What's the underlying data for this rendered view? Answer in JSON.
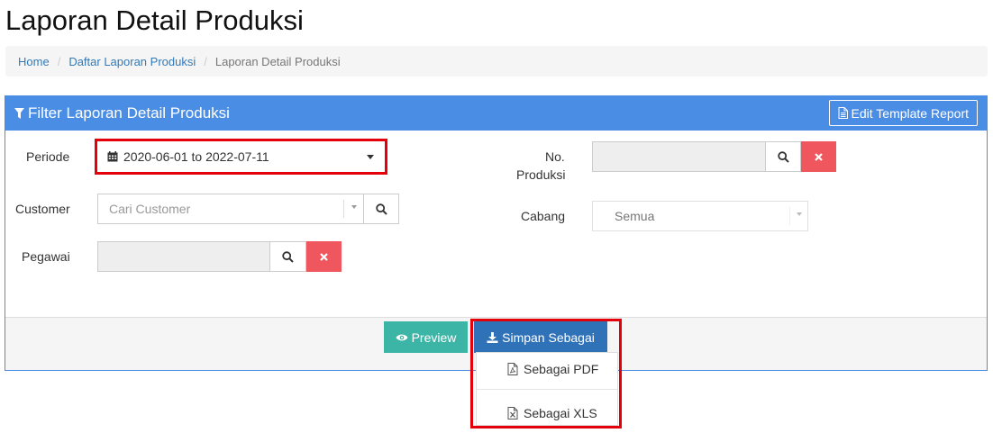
{
  "page": {
    "title": "Laporan Detail Produksi"
  },
  "breadcrumb": {
    "home": "Home",
    "list": "Daftar Laporan Produksi",
    "current": "Laporan Detail Produksi"
  },
  "panel": {
    "title": "Filter Laporan Detail Produksi",
    "edit_template": "Edit Template Report",
    "accent_color": "#4a8de5"
  },
  "filter": {
    "periode_label": "Periode",
    "periode_value": "2020-06-01 to 2022-07-11",
    "customer_label": "Customer",
    "customer_placeholder": "Cari Customer",
    "pegawai_label": "Pegawai",
    "no_produksi_label_1": "No.",
    "no_produksi_label_2": "Produksi",
    "cabang_label": "Cabang",
    "cabang_value": "Semua"
  },
  "actions": {
    "preview": "Preview",
    "simpan": "Simpan Sebagai",
    "menu": [
      {
        "label": "Sebagai PDF",
        "icon": "pdf-file-icon"
      },
      {
        "label": "Sebagai XLS",
        "icon": "excel-file-icon"
      }
    ]
  }
}
